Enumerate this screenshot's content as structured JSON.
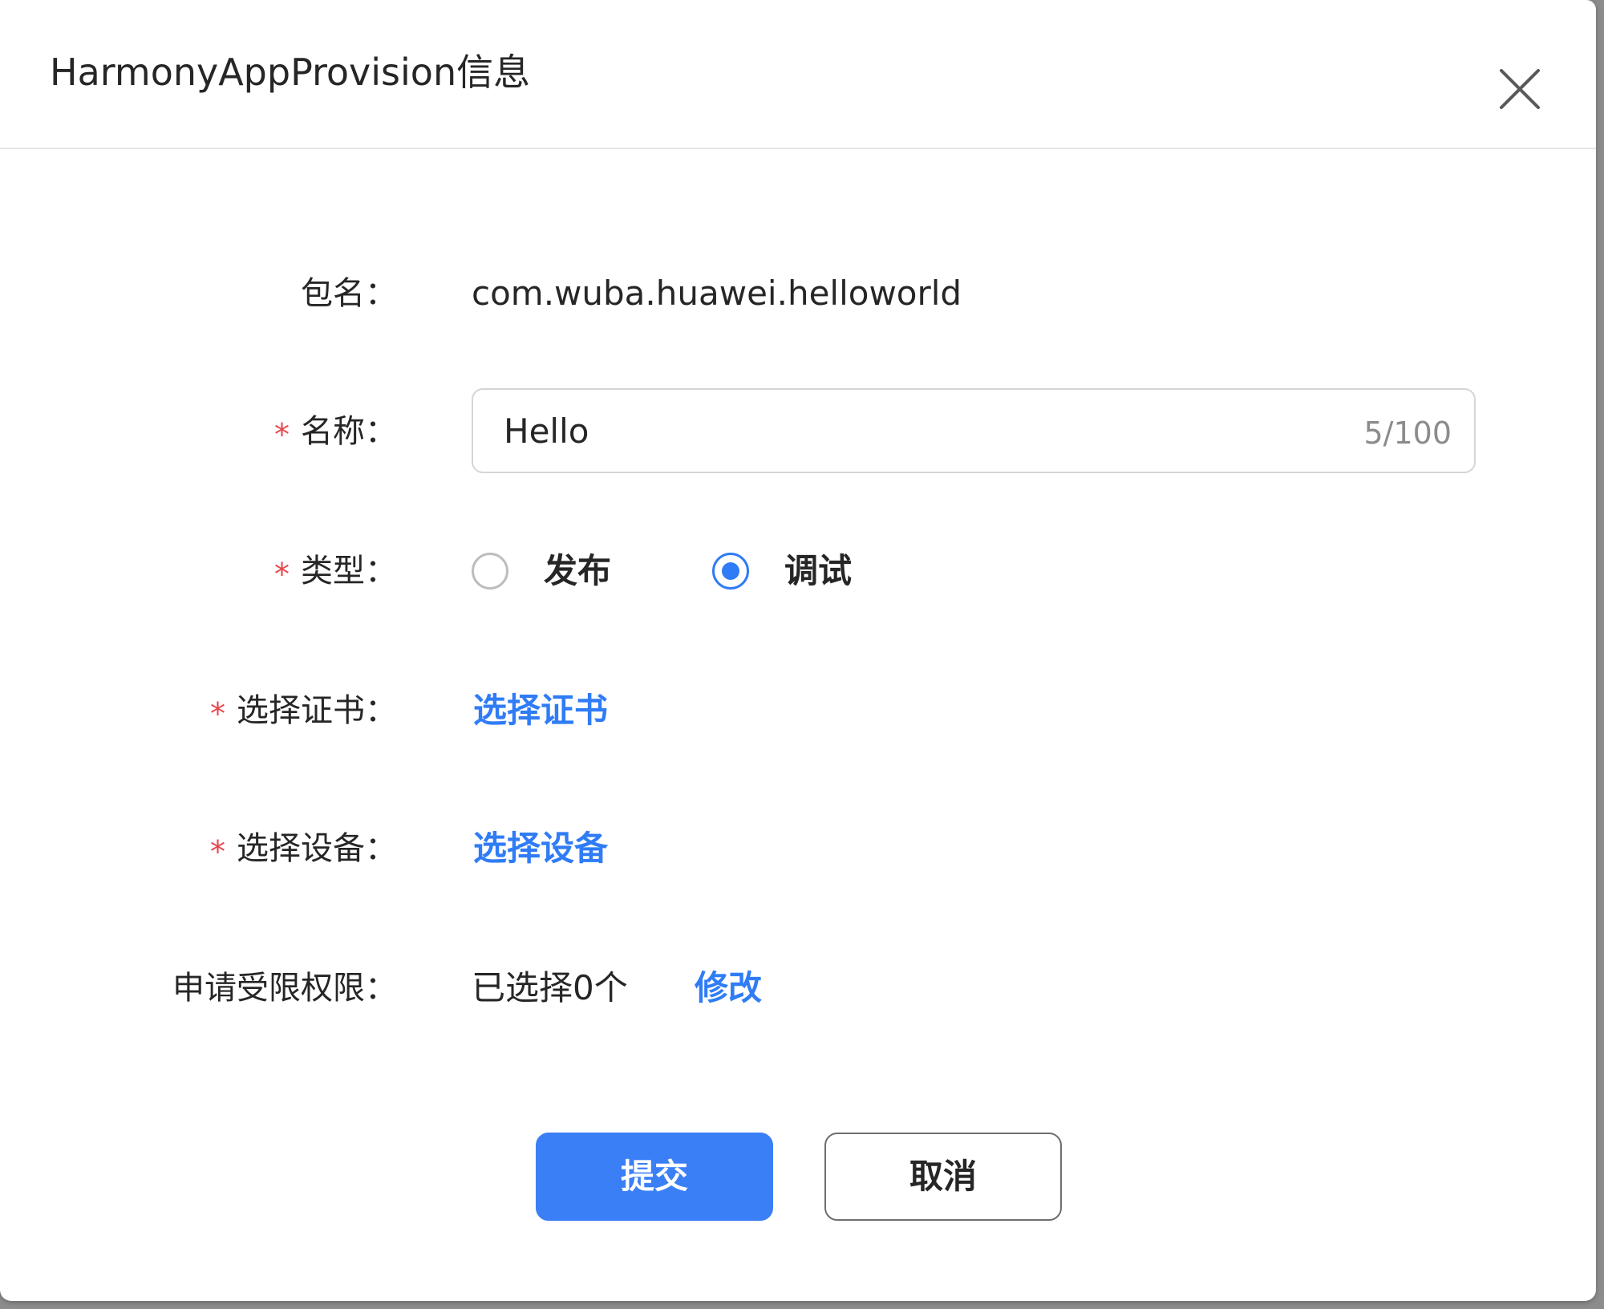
{
  "dialog": {
    "title": "HarmonyAppProvision信息"
  },
  "form": {
    "package": {
      "label": "包名：",
      "value": "com.wuba.huawei.helloworld"
    },
    "name": {
      "required_mark": "*",
      "label": "名称：",
      "value": "Hello",
      "counter": "5/100"
    },
    "type": {
      "required_mark": "*",
      "label": "类型：",
      "options": [
        {
          "label": "发布",
          "checked": false
        },
        {
          "label": "调试",
          "checked": true
        }
      ]
    },
    "certificate": {
      "required_mark": "*",
      "label": "选择证书：",
      "link": "选择证书"
    },
    "device": {
      "required_mark": "*",
      "label": "选择设备：",
      "link": "选择设备"
    },
    "permissions": {
      "label": "申请受限权限：",
      "value": "已选择0个",
      "link": "修改"
    }
  },
  "footer": {
    "submit_label": "提交",
    "cancel_label": "取消"
  },
  "colors": {
    "accent": "#2f7cf6",
    "required": "#e5484d",
    "text": "#262626",
    "muted": "#8c8c8c"
  },
  "icons": {
    "close": "close-icon"
  }
}
